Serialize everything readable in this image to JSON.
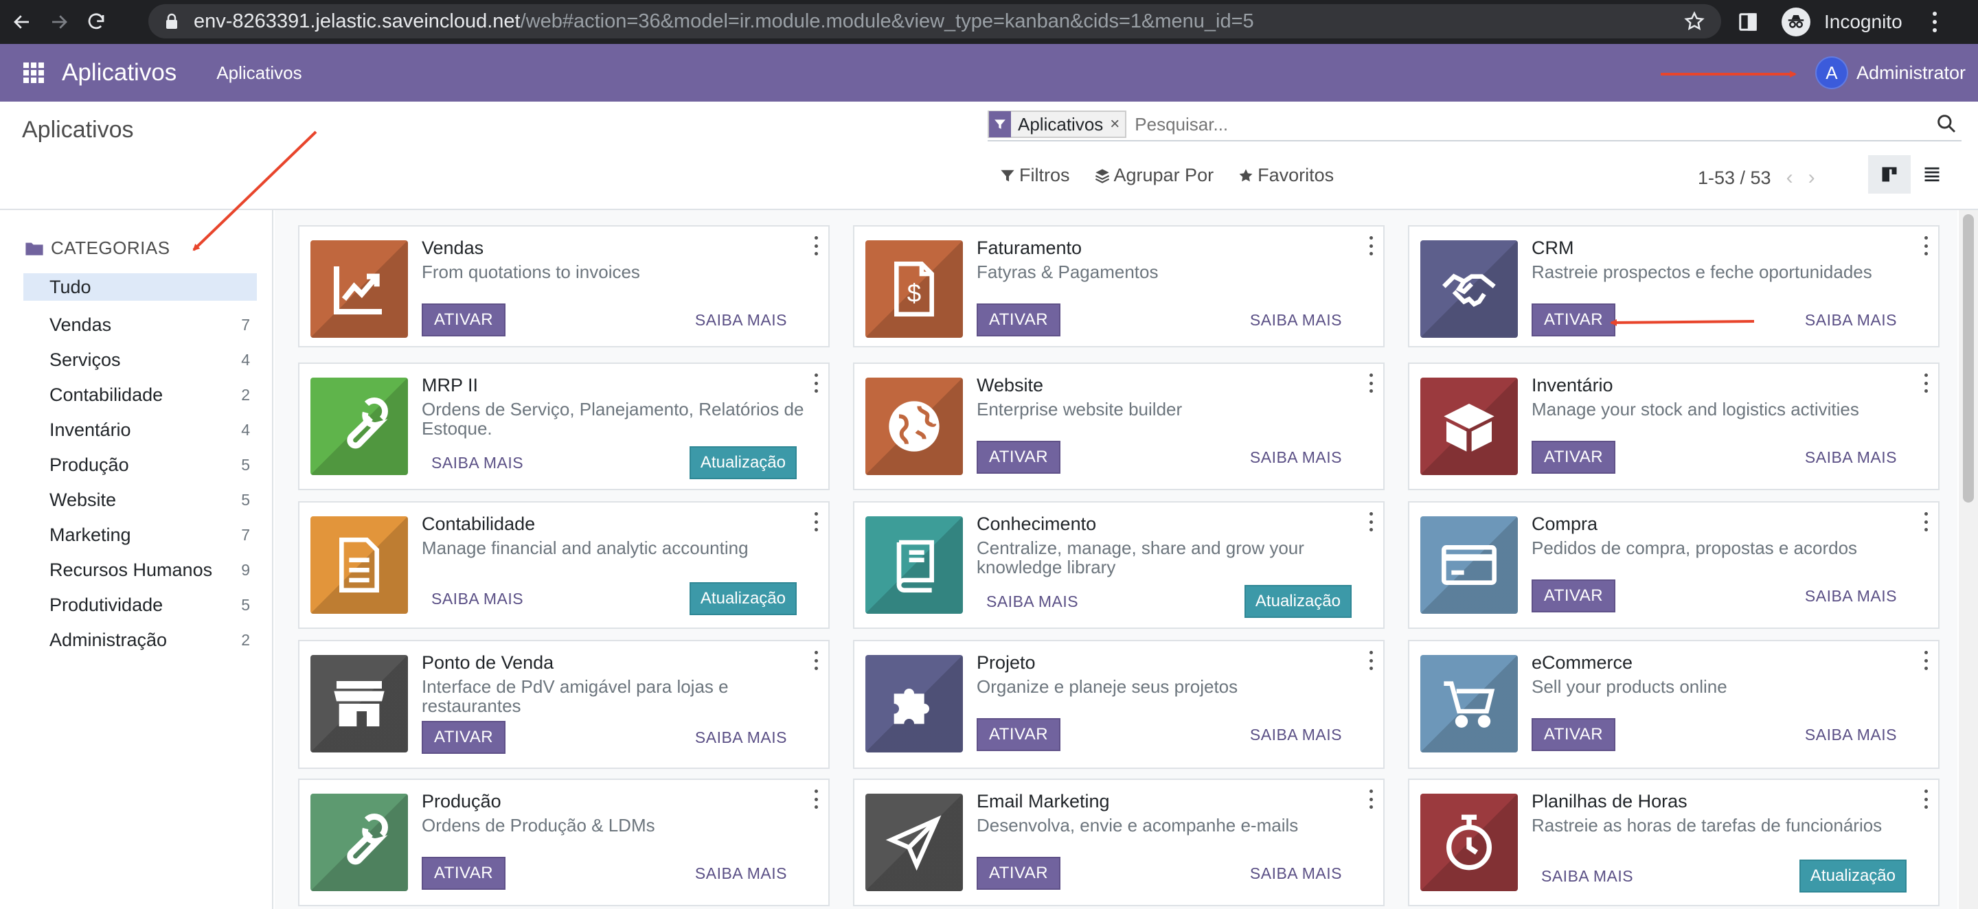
{
  "browser": {
    "url_host": "env-8263391.jelastic.saveincloud.net",
    "url_path": "/web#action=36&model=ir.module.module&view_type=kanban&cids=1&menu_id=5",
    "incognito_label": "Incognito"
  },
  "navbar": {
    "app_name": "Aplicativos",
    "menu_item": "Aplicativos",
    "user_initial": "A",
    "user_name": "Administrator"
  },
  "control_panel": {
    "title": "Aplicativos",
    "facet_value": "Aplicativos",
    "facet_close": "×",
    "search_placeholder": "Pesquisar...",
    "filters_label": "Filtros",
    "group_by_label": "Agrupar Por",
    "favorites_label": "Favoritos",
    "pager": "1-53 / 53"
  },
  "sidebar": {
    "header": "CATEGORIAS",
    "items": [
      {
        "label": "Tudo",
        "count": ""
      },
      {
        "label": "Vendas",
        "count": "7"
      },
      {
        "label": "Serviços",
        "count": "4"
      },
      {
        "label": "Contabilidade",
        "count": "2"
      },
      {
        "label": "Inventário",
        "count": "4"
      },
      {
        "label": "Produção",
        "count": "5"
      },
      {
        "label": "Website",
        "count": "5"
      },
      {
        "label": "Marketing",
        "count": "7"
      },
      {
        "label": "Recursos Humanos",
        "count": "9"
      },
      {
        "label": "Produtividade",
        "count": "5"
      },
      {
        "label": "Administração",
        "count": "2"
      }
    ]
  },
  "apps": [
    {
      "title": "Vendas",
      "desc": "From quotations to invoices",
      "primary": "ATIVAR",
      "secondary": "SAIBA MAIS",
      "color": "#c0673e",
      "icon": "chart-up-icon"
    },
    {
      "title": "Faturamento",
      "desc": "Fatyras & Pagamentos",
      "primary": "ATIVAR",
      "secondary": "SAIBA MAIS",
      "color": "#c0673e",
      "icon": "invoice-dollar-icon"
    },
    {
      "title": "CRM",
      "desc": "Rastreie prospectos e feche oportunidades",
      "primary": "ATIVAR",
      "secondary": "SAIBA MAIS",
      "color": "#5d5f8c",
      "icon": "handshake-icon"
    },
    {
      "title": "MRP II",
      "desc": "Ordens de Serviço, Planejamento, Relatórios de Estoque.",
      "primary": "SAIBA MAIS",
      "secondary": "Atualização",
      "color": "#5fb44b",
      "icon": "wrench-icon"
    },
    {
      "title": "Website",
      "desc": "Enterprise website builder",
      "primary": "ATIVAR",
      "secondary": "SAIBA MAIS",
      "color": "#c0673e",
      "icon": "globe-icon"
    },
    {
      "title": "Inventário",
      "desc": "Manage your stock and logistics activities",
      "primary": "ATIVAR",
      "secondary": "SAIBA MAIS",
      "color": "#9b3a3e",
      "icon": "box-icon"
    },
    {
      "title": "Contabilidade",
      "desc": "Manage financial and analytic accounting",
      "primary": "SAIBA MAIS",
      "secondary": "Atualização",
      "color": "#e2953b",
      "icon": "document-icon"
    },
    {
      "title": "Conhecimento",
      "desc": "Centralize, manage, share and grow your knowledge library",
      "primary": "SAIBA MAIS",
      "secondary": "Atualização",
      "color": "#3d9d98",
      "icon": "book-icon"
    },
    {
      "title": "Compra",
      "desc": "Pedidos de compra, propostas e acordos",
      "primary": "ATIVAR",
      "secondary": "SAIBA MAIS",
      "color": "#6d97b9",
      "icon": "credit-card-icon"
    },
    {
      "title": "Ponto de Venda",
      "desc": "Interface de PdV amigável para lojas e restaurantes",
      "primary": "ATIVAR",
      "secondary": "SAIBA MAIS",
      "color": "#555555",
      "icon": "store-icon"
    },
    {
      "title": "Projeto",
      "desc": "Organize e planeje seus projetos",
      "primary": "ATIVAR",
      "secondary": "SAIBA MAIS",
      "color": "#5d5f8c",
      "icon": "puzzle-icon"
    },
    {
      "title": "eCommerce",
      "desc": "Sell your products online",
      "primary": "ATIVAR",
      "secondary": "SAIBA MAIS",
      "color": "#6d97b9",
      "icon": "cart-icon"
    },
    {
      "title": "Produção",
      "desc": "Ordens de Produção & LDMs",
      "primary": "ATIVAR",
      "secondary": "SAIBA MAIS",
      "color": "#5d9a70",
      "icon": "wrench-icon"
    },
    {
      "title": "Email Marketing",
      "desc": "Desenvolva, envie e acompanhe e-mails",
      "primary": "ATIVAR",
      "secondary": "SAIBA MAIS",
      "color": "#555555",
      "icon": "paper-plane-icon"
    },
    {
      "title": "Planilhas de Horas",
      "desc": "Rastreie as horas de tarefas de funcionários",
      "primary": "SAIBA MAIS",
      "secondary": "Atualização",
      "color": "#9b3a3e",
      "icon": "stopwatch-icon"
    }
  ],
  "colors": {
    "brand": "#71639e",
    "update": "#3c99a8",
    "annotation_arrow": "#e8452c"
  }
}
